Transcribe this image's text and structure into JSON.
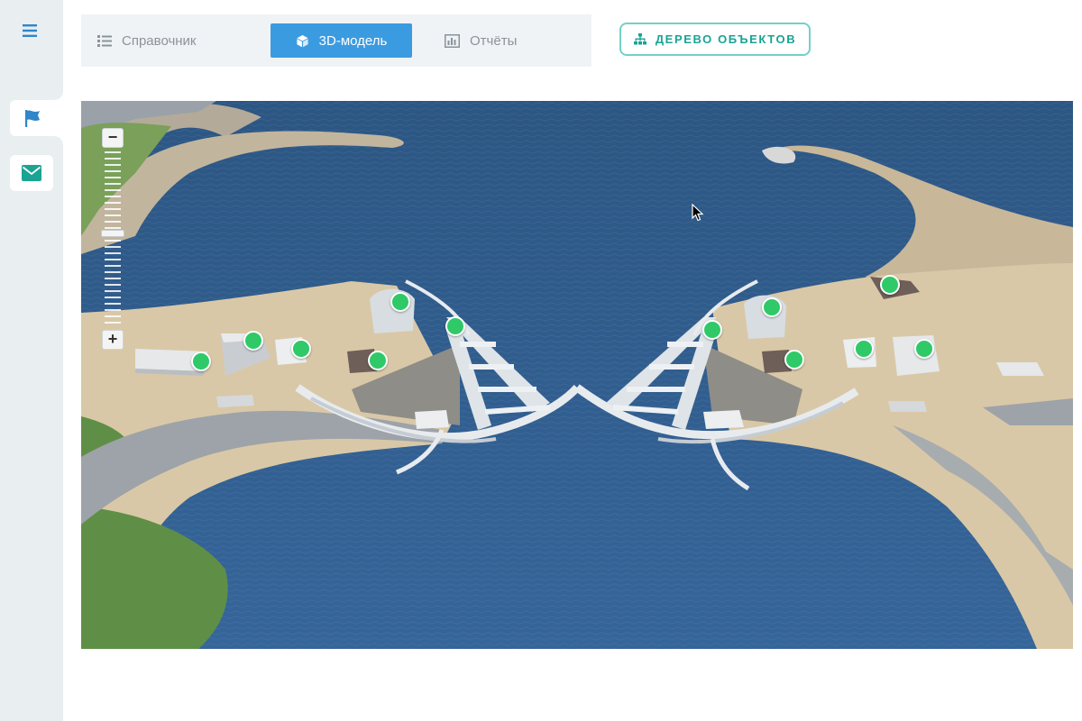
{
  "sidebar": {
    "menu_icon": "hamburger-menu-icon",
    "items": [
      {
        "icon": "flag-icon",
        "active": true,
        "color": "#2f86c9"
      },
      {
        "icon": "envelope-icon",
        "active": false,
        "color": "#1ba394"
      }
    ]
  },
  "tabs": [
    {
      "label": "Справочник",
      "icon": "list-icon",
      "active": false
    },
    {
      "label": "3D-модель",
      "icon": "cube-icon",
      "active": true
    },
    {
      "label": "Отчёты",
      "icon": "bar-chart-icon",
      "active": false
    }
  ],
  "tree_button": {
    "label": "ДЕРЕВО ОБЪЕКТОВ",
    "icon": "hierarchy-icon"
  },
  "map": {
    "zoom_level": 0.7,
    "zoom_in_label": "+",
    "zoom_out_label": "−",
    "markers": [
      {
        "status": "ok"
      },
      {
        "status": "ok"
      },
      {
        "status": "ok"
      },
      {
        "status": "ok"
      },
      {
        "status": "ok"
      },
      {
        "status": "ok"
      },
      {
        "status": "ok"
      },
      {
        "status": "ok"
      },
      {
        "status": "ok"
      },
      {
        "status": "ok"
      },
      {
        "status": "ok"
      },
      {
        "status": "ok"
      }
    ]
  },
  "colors": {
    "accent": "#3b9be0",
    "teal": "#1ba394",
    "marker": "#2fc968",
    "water": "#2f5a86",
    "land": "#d8c7a6"
  }
}
